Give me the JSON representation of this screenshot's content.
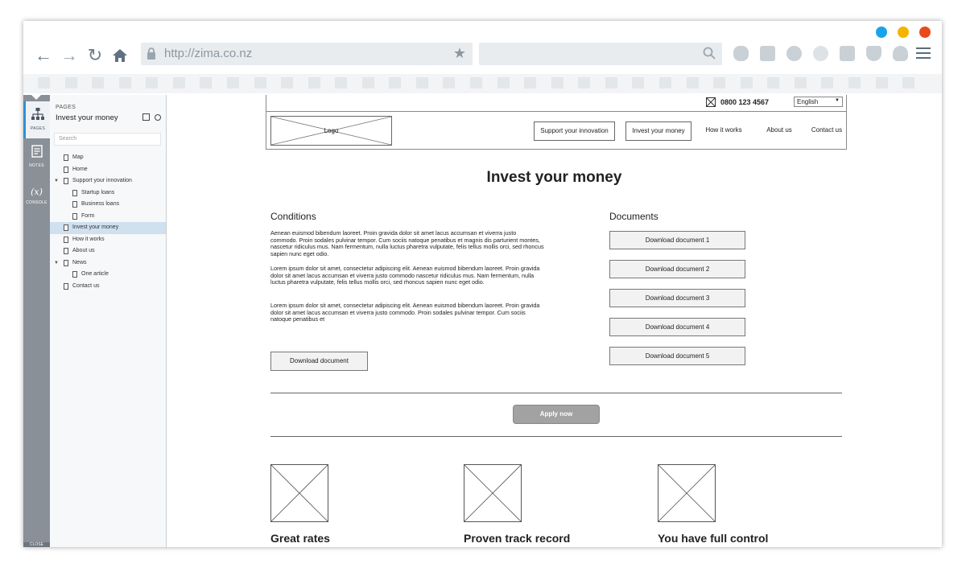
{
  "browser": {
    "url": "http://zima.co.nz",
    "window_dots": [
      "#1aa3e8",
      "#f5b400",
      "#e84a1c"
    ]
  },
  "sidebar": {
    "rail": [
      {
        "icon": "sitemap-icon",
        "label": "PAGES"
      },
      {
        "icon": "notes-icon",
        "label": "NOTES"
      },
      {
        "icon": "variable-icon",
        "label": "CONSOLE",
        "glyph": "(x)"
      }
    ],
    "rail_bottom": "CLOSE",
    "section_label": "PAGES",
    "current_page": "Invest your money",
    "search_placeholder": "Search",
    "tree": [
      {
        "label": "Map",
        "level": 0,
        "caret": false
      },
      {
        "label": "Home",
        "level": 0,
        "caret": false
      },
      {
        "label": "Support your innovation",
        "level": 0,
        "caret": true
      },
      {
        "label": "Startup loans",
        "level": 1,
        "caret": false
      },
      {
        "label": "Business loans",
        "level": 1,
        "caret": false
      },
      {
        "label": "Form",
        "level": 1,
        "caret": false
      },
      {
        "label": "Invest your money",
        "level": 0,
        "caret": false,
        "active": true
      },
      {
        "label": "How it works",
        "level": 0,
        "caret": false
      },
      {
        "label": "About us",
        "level": 0,
        "caret": false
      },
      {
        "label": "News",
        "level": 0,
        "caret": true
      },
      {
        "label": "One article",
        "level": 1,
        "caret": false
      },
      {
        "label": "Contact us",
        "level": 0,
        "caret": false
      }
    ]
  },
  "site": {
    "phone": "0800 123 4567",
    "language": "English",
    "logo": "Logo",
    "nav": [
      "Support your innovation",
      "Invest your money",
      "How it works",
      "About us",
      "Contact us"
    ],
    "title": "Invest your money",
    "conditions_title": "Conditions",
    "paragraphs": [
      "Aenean euismod bibendum laoreet. Proin gravida dolor sit amet lacus accumsan et viverra justo commodo. Proin sodales pulvinar tempor. Cum sociis natoque penatibus et magnis dis parturient montes, nascetur ridiculus mus. Nam fermentum, nulla luctus pharetra vulputate, felis tellus mollis orci, sed rhoncus sapien nunc eget odio.",
      "Lorem ipsum dolor sit amet, consectetur adipiscing elit. Aenean euismod bibendum laoreet. Proin gravida dolor sit amet lacus accumsan et viverra justo commodo nascetur ridiculus mus. Nam fermentum, nulla luctus pharetra vulputate, felis tellus mollis orci, sed rhoncus sapien nunc eget odio.",
      "Lorem ipsum dolor sit amet, consectetur adipiscing elit. Aenean euismod bibendum laoreet. Proin gravida dolor sit amet lacus accumsan et viverra justo commodo. Proin sodales pulvinar tempor. Cum sociis natoque penatibus et"
    ],
    "download_main": "Download document",
    "documents_title": "Documents",
    "documents": [
      "Download document 1",
      "Download document 2",
      "Download document 3",
      "Download document 4",
      "Download document 5"
    ],
    "apply": "Apply now",
    "features": [
      "Great rates",
      "Proven track record",
      "You have full control"
    ]
  }
}
